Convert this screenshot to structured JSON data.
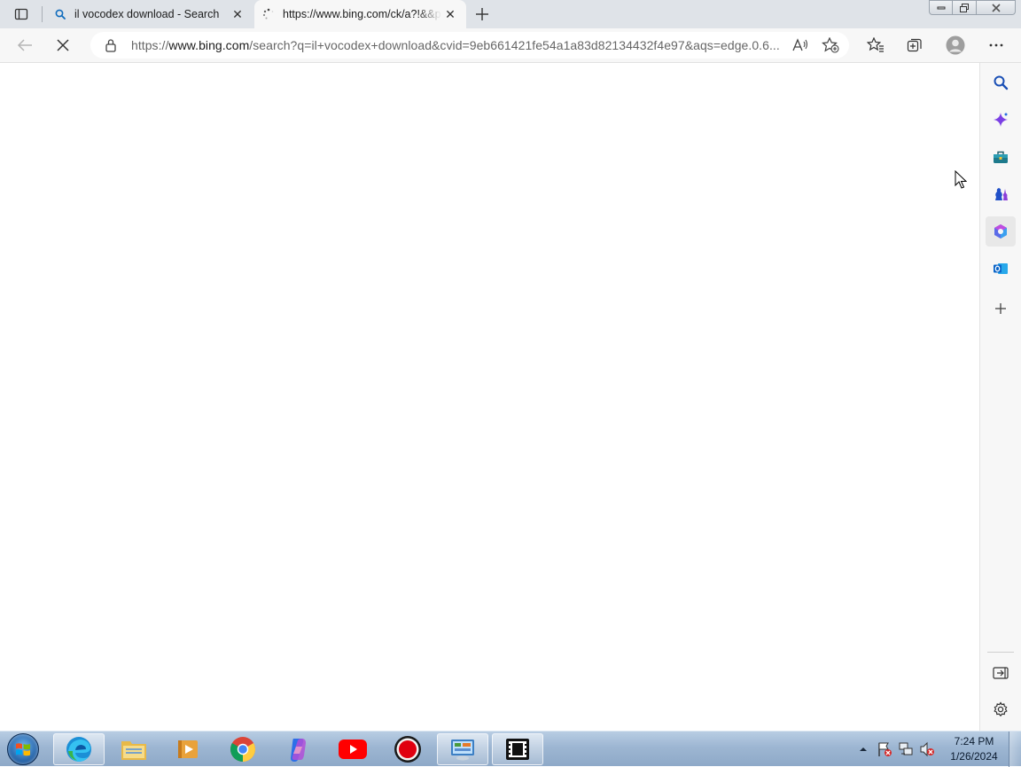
{
  "browser": {
    "tabs": [
      {
        "title": "il vocodex download - Search",
        "favicon": "search-icon",
        "active": false
      },
      {
        "title": "https://www.bing.com/ck/a?!&&p",
        "favicon": "loading-spinner-icon",
        "active": true
      }
    ],
    "address_bar": {
      "url_prefix": "https://",
      "url_host": "www.bing.com",
      "url_rest": "/search?q=il+vocodex+download&cvid=9eb661421fe54a1a83d82134432f4e97&aqs=edge.0.6..."
    },
    "loading": true,
    "accent_color": "#0f6cbd"
  },
  "taskbar": {
    "clock": {
      "time": "7:24 PM",
      "date": "1/26/2024"
    }
  }
}
